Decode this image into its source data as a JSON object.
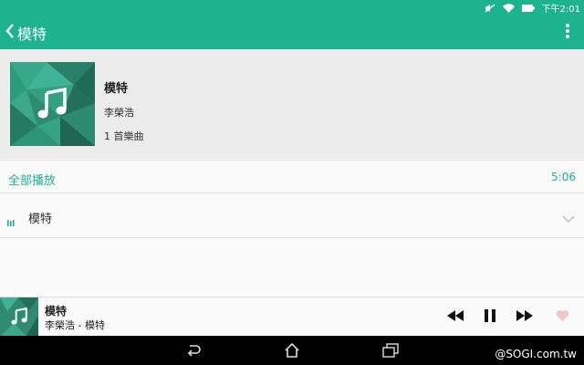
{
  "status_bar": {
    "time": "下午2:01",
    "icons": [
      "mute-icon",
      "wifi-icon",
      "battery-icon"
    ]
  },
  "app_bar": {
    "title": "模特",
    "back_icon": "chevron-left-icon",
    "menu_icon": "more-vert-icon"
  },
  "album": {
    "title": "模特",
    "artist": "李榮浩",
    "track_count": "1 首樂曲",
    "cover_icon": "music-note-icon"
  },
  "play_all": {
    "label": "全部播放",
    "duration": "5:06"
  },
  "tracks": [
    {
      "title": "模特",
      "icon": "equalizer-icon",
      "expand_icon": "chevron-down-icon"
    }
  ],
  "mini_player": {
    "title": "模特",
    "subtitle": "李榮浩 - 模特",
    "controls": [
      "rewind-icon",
      "pause-icon",
      "fast-forward-icon",
      "heart-icon"
    ]
  },
  "nav_bar": {
    "buttons": [
      "back-icon",
      "home-icon",
      "recents-icon"
    ]
  },
  "watermark": "@SOGI.com.tw",
  "colors": {
    "accent": "#1cb38e",
    "heart": "#e8c8c8",
    "nav_bg": "#000000"
  }
}
